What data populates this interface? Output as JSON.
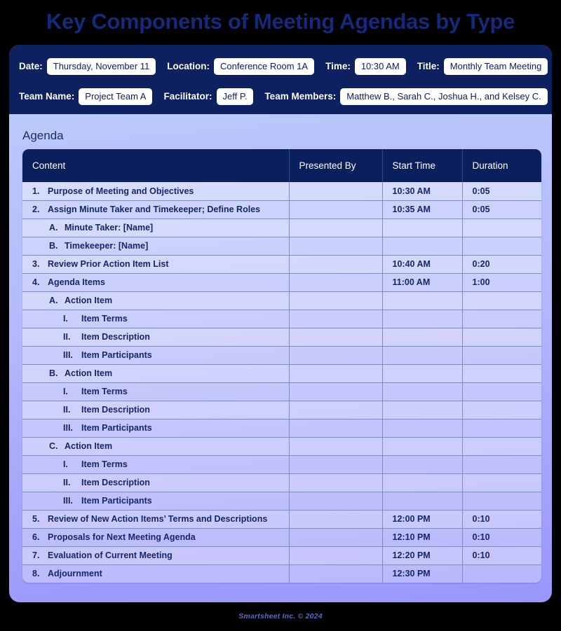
{
  "page": {
    "title": "Key Components of Meeting Agendas by Type",
    "accent_navy": "#0d2060",
    "title_color": "#152a7a",
    "gradient_top": "#bcd0fb",
    "gradient_bottom": "#9a97fb"
  },
  "info_bar": {
    "fields": [
      {
        "label": "Date:",
        "value": "Thursday, November 11"
      },
      {
        "label": "Location:",
        "value": "Conference Room 1A"
      },
      {
        "label": "Time:",
        "value": "10:30 AM"
      },
      {
        "label": "Title:",
        "value": "Monthly Team Meeting"
      },
      {
        "label": "Team Name:",
        "value": "Project Team A"
      },
      {
        "label": "Facilitator:",
        "value": "Jeff P."
      },
      {
        "label": "Team Members:",
        "value": "Matthew B., Sarah C., Joshua H., and Kelsey C."
      }
    ]
  },
  "agenda": {
    "section_label": "Agenda",
    "columns": [
      "Content",
      "Presented By",
      "Start Time",
      "Duration"
    ],
    "rows": [
      {
        "level": 1,
        "marker": "1.",
        "text": "Purpose of Meeting and Objectives",
        "presented_by": "",
        "start_time": "10:30 AM",
        "duration": "0:05"
      },
      {
        "level": 1,
        "marker": "2.",
        "text": "Assign Minute Taker and Timekeeper; Define Roles",
        "presented_by": "",
        "start_time": "10:35 AM",
        "duration": "0:05"
      },
      {
        "level": 2,
        "marker": "A.",
        "text": "Minute Taker: [Name]",
        "presented_by": "",
        "start_time": "",
        "duration": ""
      },
      {
        "level": 2,
        "marker": "B.",
        "text": "Timekeeper: [Name]",
        "presented_by": "",
        "start_time": "",
        "duration": ""
      },
      {
        "level": 1,
        "marker": "3.",
        "text": "Review Prior Action Item List",
        "presented_by": "",
        "start_time": "10:40 AM",
        "duration": "0:20"
      },
      {
        "level": 1,
        "marker": "4.",
        "text": "Agenda Items",
        "presented_by": "",
        "start_time": "11:00 AM",
        "duration": "1:00"
      },
      {
        "level": 2,
        "marker": "A.",
        "text": "Action Item",
        "presented_by": "",
        "start_time": "",
        "duration": ""
      },
      {
        "level": 3,
        "marker": "I.",
        "text": "Item Terms",
        "presented_by": "",
        "start_time": "",
        "duration": ""
      },
      {
        "level": 3,
        "marker": "II.",
        "text": "Item Description",
        "presented_by": "",
        "start_time": "",
        "duration": ""
      },
      {
        "level": 3,
        "marker": "III.",
        "text": "Item Participants",
        "presented_by": "",
        "start_time": "",
        "duration": ""
      },
      {
        "level": 2,
        "marker": "B.",
        "text": "Action Item",
        "presented_by": "",
        "start_time": "",
        "duration": ""
      },
      {
        "level": 3,
        "marker": "I.",
        "text": "Item Terms",
        "presented_by": "",
        "start_time": "",
        "duration": ""
      },
      {
        "level": 3,
        "marker": "II.",
        "text": "Item Description",
        "presented_by": "",
        "start_time": "",
        "duration": ""
      },
      {
        "level": 3,
        "marker": "III.",
        "text": "Item Participants",
        "presented_by": "",
        "start_time": "",
        "duration": ""
      },
      {
        "level": 2,
        "marker": "C.",
        "text": "Action Item",
        "presented_by": "",
        "start_time": "",
        "duration": ""
      },
      {
        "level": 3,
        "marker": "I.",
        "text": "Item Terms",
        "presented_by": "",
        "start_time": "",
        "duration": ""
      },
      {
        "level": 3,
        "marker": "II.",
        "text": "Item Description",
        "presented_by": "",
        "start_time": "",
        "duration": ""
      },
      {
        "level": 3,
        "marker": "III.",
        "text": "Item Participants",
        "presented_by": "",
        "start_time": "",
        "duration": ""
      },
      {
        "level": 1,
        "marker": "5.",
        "text": "Review of New Action Items’ Terms and Descriptions",
        "presented_by": "",
        "start_time": "12:00 PM",
        "duration": "0:10"
      },
      {
        "level": 1,
        "marker": "6.",
        "text": "Proposals for Next Meeting Agenda",
        "presented_by": "",
        "start_time": "12:10 PM",
        "duration": "0:10"
      },
      {
        "level": 1,
        "marker": "7.",
        "text": "Evaluation of Current Meeting",
        "presented_by": "",
        "start_time": "12:20 PM",
        "duration": "0:10"
      },
      {
        "level": 1,
        "marker": "8.",
        "text": "Adjournment",
        "presented_by": "",
        "start_time": "12:30 PM",
        "duration": ""
      }
    ]
  },
  "footer": {
    "text": "Smartsheet Inc. © 2024"
  }
}
